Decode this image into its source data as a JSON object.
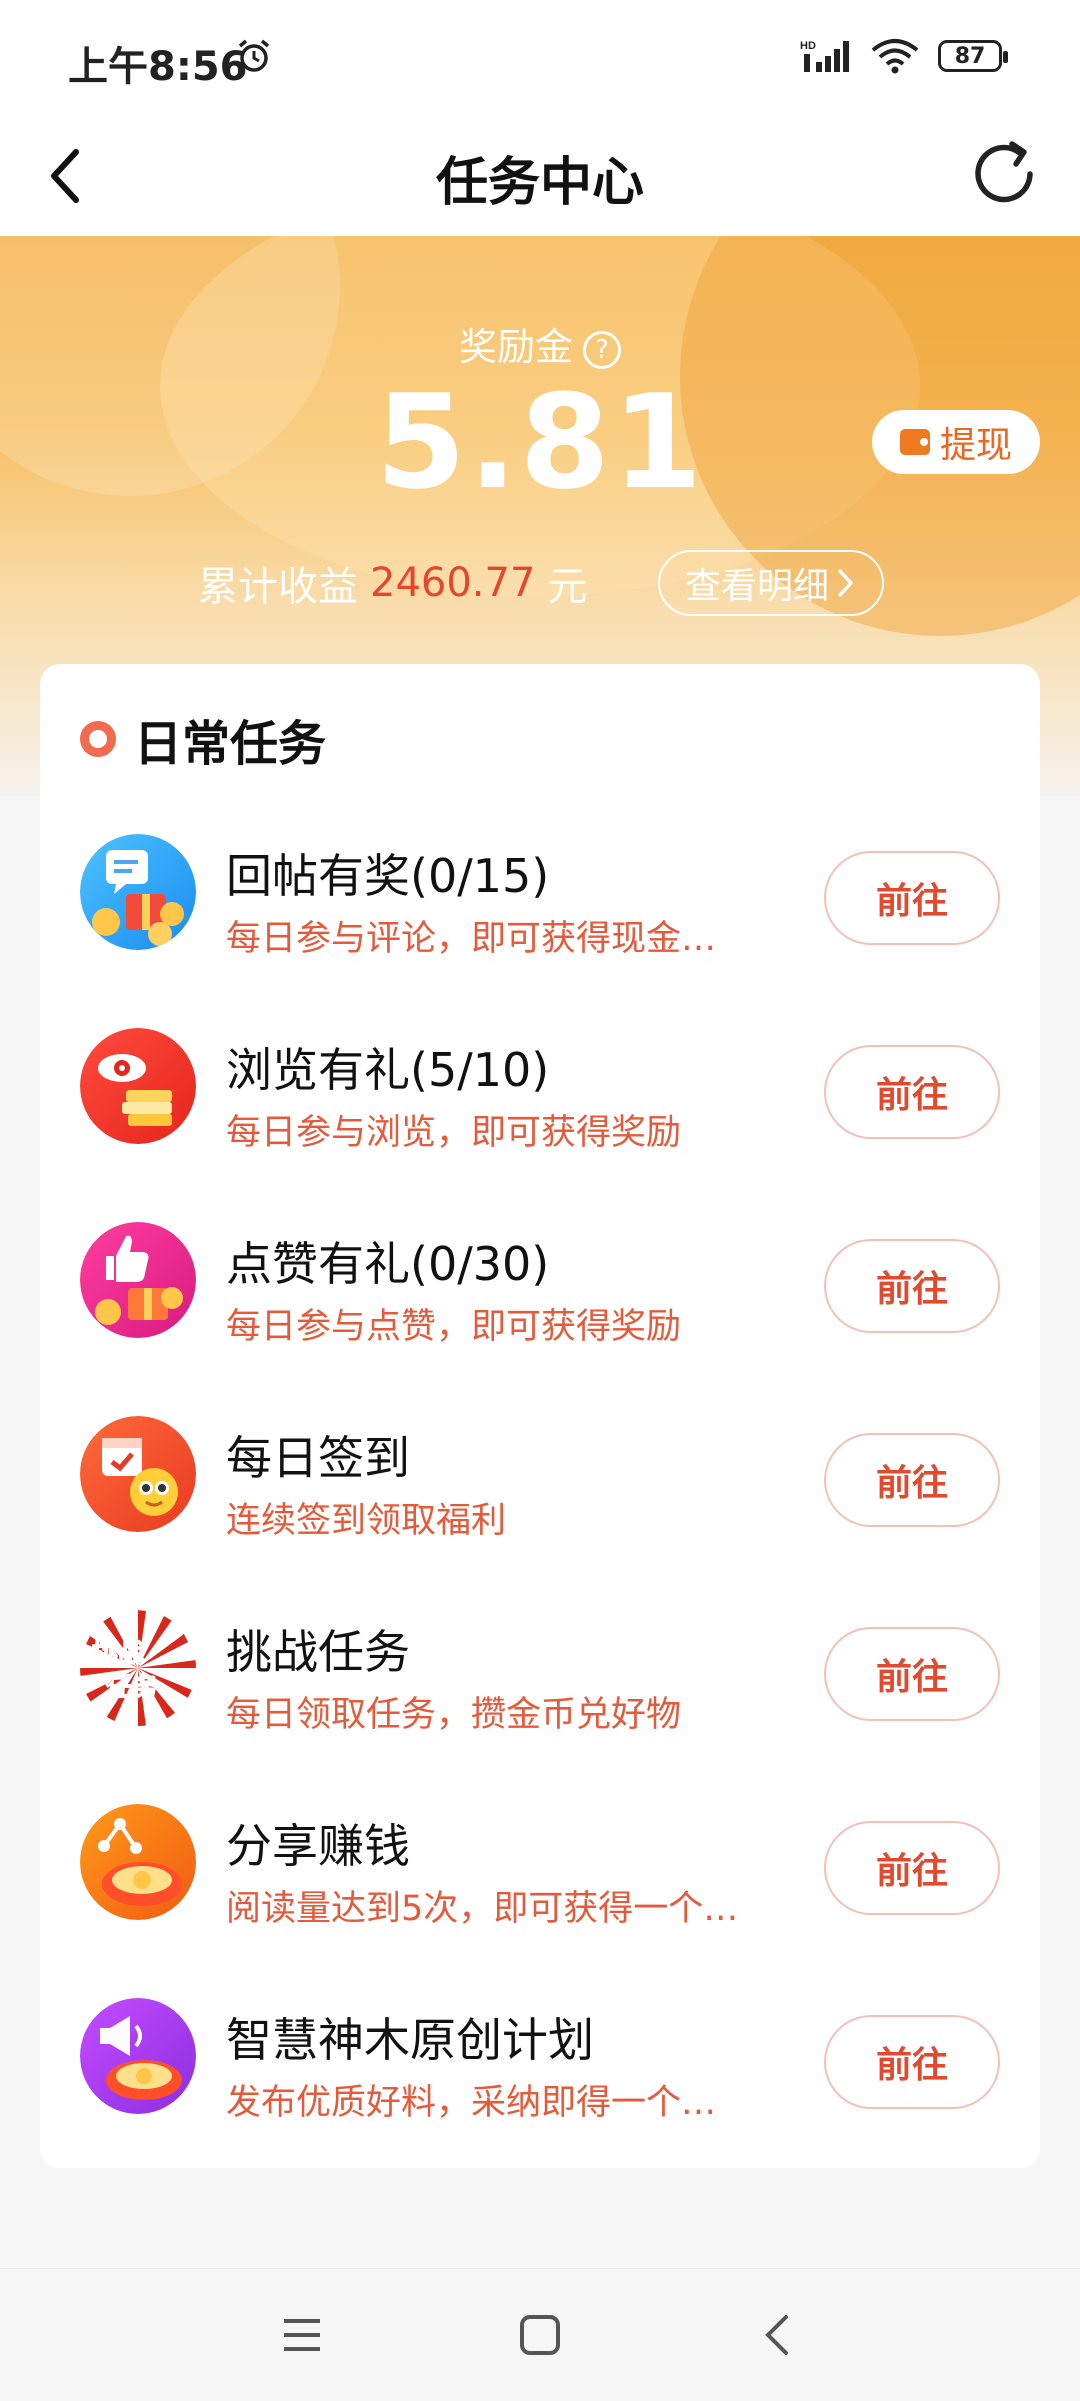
{
  "status_bar": {
    "time": "上午8:56",
    "battery": "87"
  },
  "header": {
    "title": "任务中心"
  },
  "reward": {
    "label": "奖励金",
    "amount": "5.81",
    "withdraw_label": "提现",
    "cumulative_label": "累计收益",
    "cumulative_value": "2460.77",
    "cumulative_unit": "元",
    "detail_label": "查看明细"
  },
  "daily": {
    "title": "日常任务",
    "tasks": [
      {
        "name": "回帖有奖(0/15)",
        "desc": "每日参与评论，即可获得现金…",
        "button": "前往",
        "icon": "comment-gift-icon"
      },
      {
        "name": "浏览有礼(5/10)",
        "desc": "每日参与浏览，即可获得奖励",
        "button": "前往",
        "icon": "eye-books-icon"
      },
      {
        "name": "点赞有礼(0/30)",
        "desc": "每日参与点赞，即可获得奖励",
        "button": "前往",
        "icon": "thumbs-up-icon"
      },
      {
        "name": "每日签到",
        "desc": "连续签到领取福利",
        "button": "前往",
        "icon": "calendar-checkin-icon"
      },
      {
        "name": "挑战任务",
        "desc": "每日领取任务，攒金币兑好物",
        "button": "前往",
        "icon": "challenge-icon"
      },
      {
        "name": "分享赚钱",
        "desc": "阅读量达到5次，即可获得一个…",
        "button": "前往",
        "icon": "share-icon"
      },
      {
        "name": "智慧神木原创计划",
        "desc": "发布优质好料，采纳即得一个…",
        "button": "前往",
        "icon": "megaphone-icon"
      }
    ]
  },
  "challenge_icon_text": [
    "挑战",
    "任务"
  ]
}
